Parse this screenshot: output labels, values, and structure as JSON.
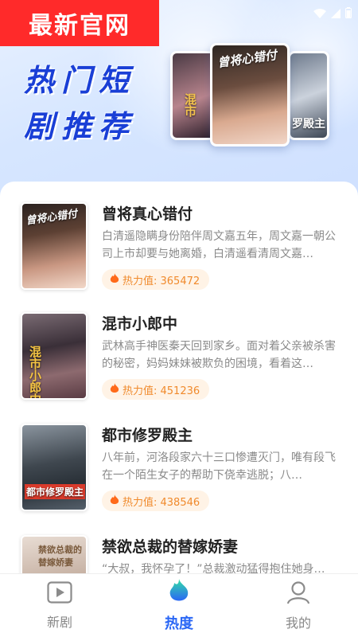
{
  "banner": {
    "badge": "最新官网",
    "title_line1": "热门短",
    "title_line2": "剧推荐",
    "posters": [
      {
        "title": "混市"
      },
      {
        "title": "曾将心错付"
      },
      {
        "title": "罗殿主"
      }
    ]
  },
  "list": [
    {
      "title": "曾将真心错付",
      "desc": "白清遥隐瞒身份陪伴周文嘉五年，周文嘉一朝公司上市却要与她离婚，白清遥看清周文嘉…",
      "heat_label": "热力值: 365472",
      "cover_text": "曾将心错付"
    },
    {
      "title": "混市小郎中",
      "desc": "武林高手神医秦天回到家乡。面对着父亲被杀害的秘密，妈妈妹妹被欺负的困境，看着这…",
      "heat_label": "热力值: 451236",
      "cover_text": "混市小郎中"
    },
    {
      "title": "都市修罗殿主",
      "desc": "八年前，河洛段家六十三口惨遭灭门，唯有段飞在一个陌生女子的帮助下侥幸逃脱；八…",
      "heat_label": "热力值: 438546",
      "cover_text": "都市修罗殿主"
    },
    {
      "title": "禁欲总裁的替嫁娇妻",
      "desc": "“大叔，我怀孕了！”总裁激动猛得抱住她身…",
      "heat_label": "",
      "cover_text": "禁欲总裁的替嫁娇妻"
    }
  ],
  "tabs": [
    {
      "label": "新剧",
      "icon": "play-video-icon",
      "active": false
    },
    {
      "label": "热度",
      "icon": "flame-icon",
      "active": true
    },
    {
      "label": "我的",
      "icon": "user-profile-icon",
      "active": false
    }
  ],
  "colors": {
    "accent": "#2a67f5",
    "badge_red": "#ff2a2a",
    "heat_orange": "#f08a2c",
    "heat_bg": "#fff3e6"
  }
}
